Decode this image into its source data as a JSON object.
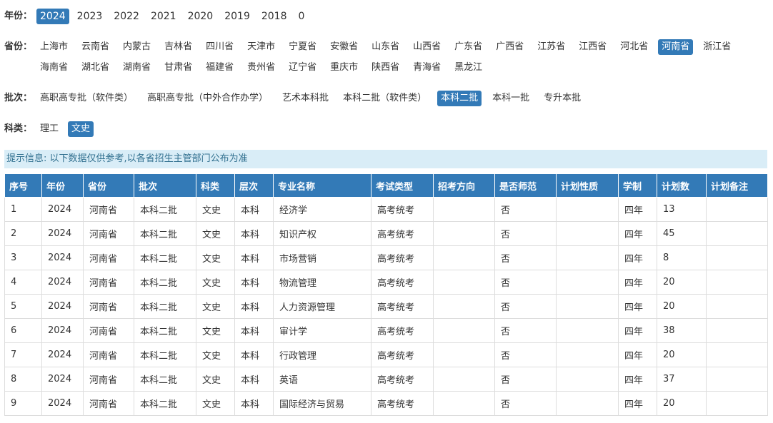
{
  "filters": {
    "year": {
      "label": "年份：",
      "options": [
        "2024",
        "2023",
        "2022",
        "2021",
        "2020",
        "2019",
        "2018",
        "0"
      ],
      "selected": "2024"
    },
    "province": {
      "label": "省份：",
      "options": [
        "上海市",
        "云南省",
        "内蒙古",
        "吉林省",
        "四川省",
        "天津市",
        "宁夏省",
        "安徽省",
        "山东省",
        "山西省",
        "广东省",
        "广西省",
        "江苏省",
        "江西省",
        "河北省",
        "河南省",
        "浙江省",
        "海南省",
        "湖北省",
        "湖南省",
        "甘肃省",
        "福建省",
        "贵州省",
        "辽宁省",
        "重庆市",
        "陕西省",
        "青海省",
        "黑龙江"
      ],
      "selected": "河南省"
    },
    "batch": {
      "label": "批次：",
      "options": [
        "高职高专批（软件类）",
        "高职高专批（中外合作办学）",
        "艺术本科批",
        "本科二批（软件类）",
        "本科二批",
        "本科一批",
        "专升本批"
      ],
      "selected": "本科二批"
    },
    "category": {
      "label": "科类：",
      "options": [
        "理工",
        "文史"
      ],
      "selected": "文史"
    }
  },
  "notice": "提示信息: 以下数据仅供参考,以各省招生主管部门公布为准",
  "table": {
    "columns": [
      "序号",
      "年份",
      "省份",
      "批次",
      "科类",
      "层次",
      "专业名称",
      "考试类型",
      "招考方向",
      "是否师范",
      "计划性质",
      "学制",
      "计划数",
      "计划备注"
    ],
    "rows": [
      [
        "1",
        "2024",
        "河南省",
        "本科二批",
        "文史",
        "本科",
        "经济学",
        "高考统考",
        "",
        "否",
        "",
        "四年",
        "13",
        ""
      ],
      [
        "2",
        "2024",
        "河南省",
        "本科二批",
        "文史",
        "本科",
        "知识产权",
        "高考统考",
        "",
        "否",
        "",
        "四年",
        "45",
        ""
      ],
      [
        "3",
        "2024",
        "河南省",
        "本科二批",
        "文史",
        "本科",
        "市场营销",
        "高考统考",
        "",
        "否",
        "",
        "四年",
        "8",
        ""
      ],
      [
        "4",
        "2024",
        "河南省",
        "本科二批",
        "文史",
        "本科",
        "物流管理",
        "高考统考",
        "",
        "否",
        "",
        "四年",
        "20",
        ""
      ],
      [
        "5",
        "2024",
        "河南省",
        "本科二批",
        "文史",
        "本科",
        "人力资源管理",
        "高考统考",
        "",
        "否",
        "",
        "四年",
        "20",
        ""
      ],
      [
        "6",
        "2024",
        "河南省",
        "本科二批",
        "文史",
        "本科",
        "审计学",
        "高考统考",
        "",
        "否",
        "",
        "四年",
        "38",
        ""
      ],
      [
        "7",
        "2024",
        "河南省",
        "本科二批",
        "文史",
        "本科",
        "行政管理",
        "高考统考",
        "",
        "否",
        "",
        "四年",
        "20",
        ""
      ],
      [
        "8",
        "2024",
        "河南省",
        "本科二批",
        "文史",
        "本科",
        "英语",
        "高考统考",
        "",
        "否",
        "",
        "四年",
        "37",
        ""
      ],
      [
        "9",
        "2024",
        "河南省",
        "本科二批",
        "文史",
        "本科",
        "国际经济与贸易",
        "高考统考",
        "",
        "否",
        "",
        "四年",
        "20",
        ""
      ]
    ]
  }
}
